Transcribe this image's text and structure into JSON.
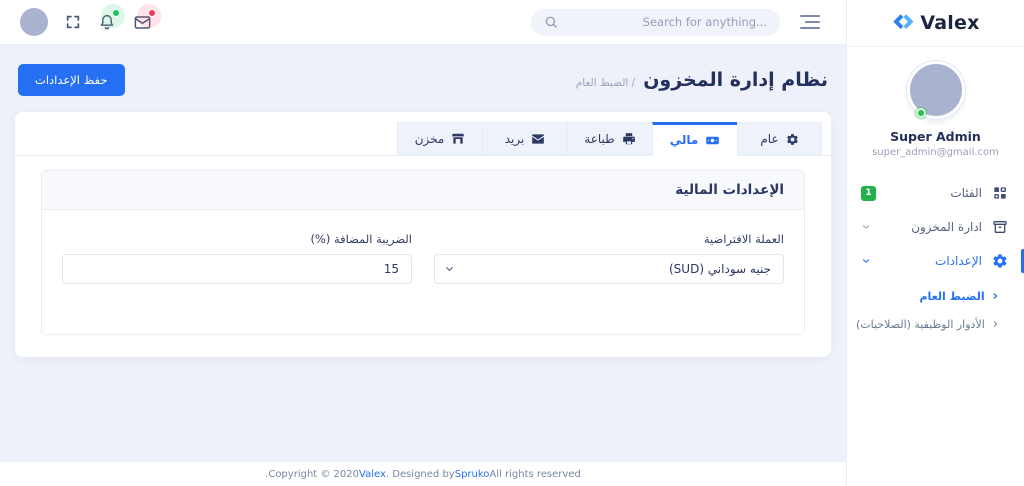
{
  "topbar": {
    "search_placeholder": "...Search for anything",
    "icons": {
      "avatar": "user-avatar",
      "fullscreen": "expand-corners",
      "bell": "notification-bell-green-dot",
      "mail": "envelope-red-dot",
      "search": "magnifier",
      "menu": "hamburger-lines"
    }
  },
  "page": {
    "title": "نظام إدارة المخزون",
    "breadcrumb": "/ الضبط العام",
    "save_button": "حفظ الإعدادات"
  },
  "tabs": {
    "items": [
      {
        "label": "عام",
        "icon": "gear",
        "active": false
      },
      {
        "label": "مالي",
        "icon": "money-bill",
        "active": true
      },
      {
        "label": "طباعة",
        "icon": "printer",
        "active": false
      },
      {
        "label": "بريد",
        "icon": "envelope",
        "active": false
      },
      {
        "label": "مخزن",
        "icon": "store",
        "active": false
      }
    ]
  },
  "panel": {
    "title": "الإعدادات المالية",
    "currency": {
      "label": "العملة الافتراضية",
      "value": "جنيه سوداني (SUD)"
    },
    "tax": {
      "label": "الضريبة المضافة (%)",
      "value": "15"
    }
  },
  "sidebar": {
    "brand": "Valex",
    "user": {
      "name": "Super Admin",
      "email": "super_admin@gmail.com"
    },
    "menu": [
      {
        "label": "الفئات",
        "icon": "grid-categories",
        "badge": "1"
      },
      {
        "label": "ادارة المخزون",
        "icon": "archive-box",
        "chevron": "down"
      },
      {
        "label": "الإعدادات",
        "icon": "gear",
        "chevron": "down",
        "active": true
      }
    ],
    "submenu": [
      {
        "label": "الضبط العام",
        "arrow": "‹",
        "active": true
      },
      {
        "label": "الأدوار الوظيفية (الصلاحيات)",
        "arrow": "‹",
        "active": false
      }
    ]
  },
  "footer": {
    "prefix": ".Copyright © 2020 ",
    "brand_link": "Valex",
    "middle": ". Designed by ",
    "designer_link": "Spruko",
    "suffix": " All rights reserved"
  },
  "colors": {
    "primary": "#2570f2",
    "heading_navy": "#24305e",
    "page_bg": "#eef1f9",
    "badge_green": "#22b24c",
    "status_green": "#2fbe51",
    "bell_dot_green": "#17c653",
    "mail_dot_red": "#f5365c",
    "avatar_gray": "#a9b2cf",
    "logo_blue_dark": "#2e7ef0",
    "logo_blue_light": "#55b2f8"
  }
}
